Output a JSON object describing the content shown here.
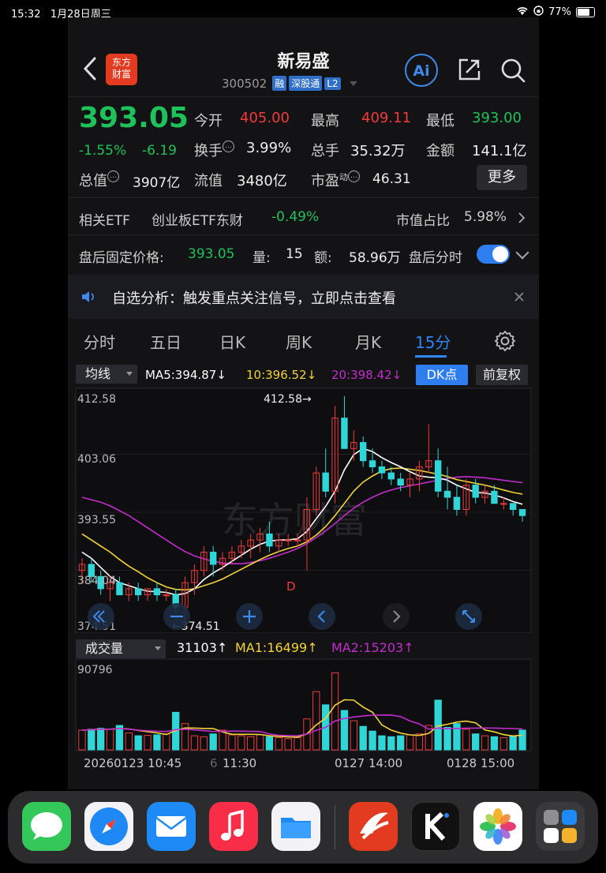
{
  "status_bar": {
    "time": "15:32",
    "date": "1月28日周三",
    "battery": "77%"
  },
  "header": {
    "logo_line1": "东方",
    "logo_line2": "财富",
    "stock_name": "新易盛",
    "stock_code": "300502",
    "tag_margin": "融",
    "tag_connect": "深股通",
    "tag_level": "L2",
    "ai_label": "Ai"
  },
  "quote": {
    "price": "393.05",
    "change_pct": "-1.55%",
    "change_amt": "-6.19",
    "open_label": "今开",
    "open": "405.00",
    "high_label": "最高",
    "high": "409.11",
    "low_label": "最低",
    "low": "393.00",
    "turnover_label": "换手",
    "turnover": "3.99%",
    "volume_label": "总手",
    "volume": "35.32万",
    "amount_label": "金额",
    "amount": "141.1亿",
    "mcap_label": "总值",
    "mcap": "3907亿",
    "float_label": "流值",
    "float": "3480亿",
    "pe_label": "市盈",
    "pe_sup": "动",
    "pe": "46.31",
    "more_label": "更多"
  },
  "etf": {
    "label": "相关ETF",
    "name": "创业板ETF东财",
    "change": "-0.49%",
    "ratio_label": "市值占比",
    "ratio": "5.98%"
  },
  "after_hours": {
    "price_label": "盘后固定价格:",
    "price": "393.05",
    "qty_label": "量:",
    "qty": "15",
    "amount_label": "额:",
    "amount": "58.96万",
    "toggle_label": "盘后分时"
  },
  "notice": {
    "text": "自选分析：触发重点关注信号，立即点击查看"
  },
  "tabs": [
    "分时",
    "五日",
    "日K",
    "周K",
    "月K",
    "15分"
  ],
  "ma_bar": {
    "selector": "均线",
    "ma5": "MA5:394.87↓",
    "ma10": "10:396.52↓",
    "ma20": "20:398.42↓",
    "dk_label": "DK点",
    "adj_label": "前复权"
  },
  "volume_bar": {
    "selector": "成交量",
    "vol": "31103↑",
    "ma1": "MA1:16499↑",
    "ma2": "MA2:15203↑"
  },
  "time_axis": {
    "start": "20260123 10:45",
    "mid_hidden": "6",
    "t1": "11:30",
    "t2": "0127 14:00",
    "t3": "0128 15:00"
  },
  "colors": {
    "up": "#f23b3b",
    "down": "#1fc25a",
    "accent": "#2f7ef0",
    "ma5": "#ffffff",
    "ma10": "#f2d33a",
    "ma20": "#c22ccb",
    "cyan": "#2fd6d8"
  },
  "chart_data": {
    "type": "candlestick",
    "y_axis_labels": [
      "412.58",
      "403.06",
      "393.55",
      "384.04",
      "374.51"
    ],
    "ylim": [
      374.51,
      412.58
    ],
    "high_marker": "412.58→",
    "low_marker": "←374.51",
    "signal_label": "D",
    "candles": [
      [
        384,
        386,
        382,
        385
      ],
      [
        385,
        386,
        382,
        383
      ],
      [
        383,
        384,
        380,
        381
      ],
      [
        381,
        383,
        379,
        382
      ],
      [
        382,
        383,
        380,
        380
      ],
      [
        380,
        382,
        379,
        381
      ],
      [
        381,
        382,
        379,
        380
      ],
      [
        380,
        381,
        379,
        381
      ],
      [
        381,
        382,
        379,
        380
      ],
      [
        380,
        381,
        379,
        380
      ],
      [
        380,
        381,
        377,
        378
      ],
      [
        378,
        383,
        374.51,
        382
      ],
      [
        382,
        385,
        380,
        384
      ],
      [
        384,
        388,
        383,
        387
      ],
      [
        387,
        388,
        383,
        385
      ],
      [
        385,
        387,
        384,
        386
      ],
      [
        386,
        388,
        385,
        387
      ],
      [
        387,
        389,
        386,
        388
      ],
      [
        388,
        390,
        386,
        389
      ],
      [
        389,
        391,
        387,
        390
      ],
      [
        390,
        392,
        387,
        388
      ],
      [
        388,
        390,
        387,
        389
      ],
      [
        389,
        390,
        388,
        389
      ],
      [
        389,
        390,
        388,
        389
      ],
      [
        389,
        396,
        384,
        394
      ],
      [
        394,
        401,
        393,
        400
      ],
      [
        400,
        404,
        396,
        397
      ],
      [
        397,
        411,
        395,
        409
      ],
      [
        409,
        412.58,
        405,
        404
      ],
      [
        404,
        407,
        402,
        405
      ],
      [
        405,
        406,
        401,
        402
      ],
      [
        402,
        404,
        400,
        401
      ],
      [
        401,
        402,
        399,
        400
      ],
      [
        400,
        401,
        398,
        399
      ],
      [
        399,
        400,
        397,
        398
      ],
      [
        398,
        400,
        396,
        399
      ],
      [
        399,
        402,
        397,
        401
      ],
      [
        401,
        408,
        400,
        402
      ],
      [
        402,
        404,
        396,
        397
      ],
      [
        397,
        401,
        394,
        396
      ],
      [
        396,
        398,
        393,
        394
      ],
      [
        394,
        399,
        393,
        398
      ],
      [
        398,
        399,
        395,
        396
      ],
      [
        396,
        398,
        395,
        397
      ],
      [
        397,
        398,
        395,
        395
      ],
      [
        395,
        396,
        394,
        395
      ],
      [
        395,
        395,
        393,
        394
      ],
      [
        394,
        394,
        392,
        393
      ]
    ],
    "ma5": [
      387,
      386,
      384.5,
      383,
      382,
      381.5,
      381,
      380.6,
      380.5,
      380.4,
      380,
      380.2,
      381,
      382.5,
      383.6,
      384.5,
      385.5,
      386.5,
      387.5,
      388.3,
      388.8,
      389,
      389,
      389.2,
      390.4,
      392.5,
      394.5,
      397,
      400.5,
      403,
      404,
      403.5,
      402.5,
      401.7,
      401,
      400.2,
      399.5,
      399.3,
      399.2,
      398.8,
      398,
      397.4,
      396.8,
      396.7,
      396.4,
      395.9,
      395.3,
      394.87
    ],
    "ma10": [
      390,
      389,
      388,
      387,
      385.8,
      384.7,
      383.8,
      382.8,
      382,
      381.3,
      380.9,
      380.8,
      381,
      381.5,
      382,
      382.6,
      383.4,
      384.2,
      385,
      385.8,
      386.5,
      387.1,
      387.6,
      388,
      388.7,
      389.8,
      391.2,
      393,
      395,
      397,
      398.5,
      399.5,
      400.3,
      400.7,
      400.8,
      400.6,
      400.4,
      400.1,
      399.8,
      399.4,
      398.9,
      398.6,
      398.3,
      398,
      397.6,
      397.2,
      396.8,
      396.52
    ],
    "ma20": [
      396,
      395.6,
      395.2,
      394.6,
      393.8,
      393,
      392,
      391,
      390,
      389,
      388,
      387.1,
      386.4,
      385.9,
      385.5,
      385.2,
      385.1,
      385.1,
      385.3,
      385.6,
      386,
      386.5,
      387,
      387.6,
      388.4,
      389.4,
      390.5,
      391.7,
      393,
      394.2,
      395.2,
      396,
      396.7,
      397.2,
      397.6,
      397.9,
      398.2,
      398.5,
      398.8,
      399.1,
      399.3,
      399.4,
      399.3,
      399.2,
      399,
      398.8,
      398.6,
      398.42
    ],
    "volume": {
      "max_label": "90796",
      "ylim": [
        0,
        90796
      ],
      "values": [
        21000,
        22000,
        23000,
        22000,
        26000,
        18000,
        15000,
        15500,
        16000,
        17000,
        40000,
        28000,
        15000,
        14000,
        17000,
        21000,
        16000,
        15000,
        14000,
        16000,
        14000,
        13000,
        12000,
        13000,
        33000,
        62000,
        48000,
        82000,
        42000,
        31000,
        25000,
        20000,
        15000,
        14000,
        15000,
        16000,
        17000,
        26000,
        53000,
        24000,
        28000,
        22000,
        17000,
        15000,
        14000,
        13000,
        15000,
        21000
      ]
    }
  }
}
